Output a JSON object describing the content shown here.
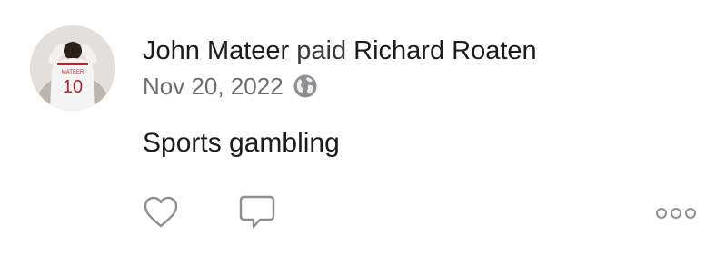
{
  "story": {
    "sender": "John Mateer",
    "verb": "paid",
    "recipient": "Richard Roaten",
    "date": "Nov 20, 2022",
    "note": "Sports gambling",
    "avatar_jersey_number": "10",
    "avatar_jersey_name": "MATEER"
  },
  "icons": {
    "privacy": "globe-icon",
    "like": "heart-icon",
    "comment": "comment-bubble-icon",
    "more": "more-options-icon"
  },
  "colors": {
    "text_primary": "#1c1c1e",
    "text_secondary": "#6d6d72",
    "icon": "#8e8e93",
    "jersey": "#f4f4f4",
    "jersey_accent": "#b3262d"
  }
}
